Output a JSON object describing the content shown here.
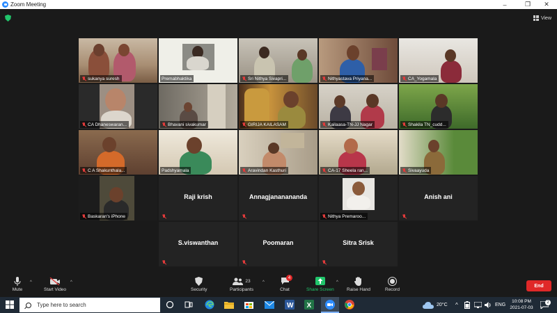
{
  "window": {
    "title": "Zoom Meeting",
    "controls": [
      "–",
      "❐",
      "✕"
    ]
  },
  "header": {
    "view_label": "View"
  },
  "participants_grid": [
    {
      "name": "sukanya suresh",
      "video": true
    },
    {
      "name": "Premabhaktika",
      "video": true,
      "active_speaker": true
    },
    {
      "name": "Sri Nithya Sivapri...",
      "video": true
    },
    {
      "name": "Nithyastava Priyana...",
      "video": true
    },
    {
      "name": "CA_Yogamala",
      "video": true
    },
    {
      "name": "CA Dhaneswaran...",
      "video": true
    },
    {
      "name": "Bhavani sivakumar",
      "video": true
    },
    {
      "name": "GIRIJA KAILASAM",
      "video": true
    },
    {
      "name": "Kailaasa-TN-JJ Nagar",
      "video": true
    },
    {
      "name": "Shakila TN_cudd...",
      "video": true
    },
    {
      "name": "C A Shakunthala...",
      "video": true
    },
    {
      "name": "Padshyamala",
      "video": true
    },
    {
      "name": "Aravindan Kasthuri",
      "video": true
    },
    {
      "name": "CA-17 Sheela ran...",
      "video": true
    },
    {
      "name": "Sivaayuda",
      "video": true
    },
    {
      "name": "Baskaran's iPhone",
      "video": true
    },
    {
      "name": "Raji krish",
      "video": false
    },
    {
      "name": "Annagjananananda",
      "video": false
    },
    {
      "name": "Nithya Premaroo...",
      "video": true
    },
    {
      "name": "Anish ani",
      "video": false
    },
    {
      "name": "S.viswanthan",
      "video": false
    },
    {
      "name": "Poomaran",
      "video": false
    },
    {
      "name": "Sitra Srisk",
      "video": false
    }
  ],
  "toolbar": {
    "mute": "Mute",
    "start_video": "Start Video",
    "security": "Security",
    "participants": "Participants",
    "participants_count": "23",
    "chat": "Chat",
    "chat_badge": "4",
    "share_screen": "Share Screen",
    "raise_hand": "Raise Hand",
    "record": "Record",
    "end": "End"
  },
  "taskbar": {
    "search_placeholder": "Type here to search",
    "weather": "20°C",
    "language": "ENG",
    "time": "10:08 PM",
    "date": "2021-07-03",
    "notification_count": "2"
  },
  "colors": {
    "meeting_bg": "#1a1a1a",
    "tile_bg": "#232323",
    "active_outline": "#c8d94a",
    "share_green": "#21c56b",
    "end_red": "#e02828",
    "taskbar_bg": "#1f2a36"
  }
}
